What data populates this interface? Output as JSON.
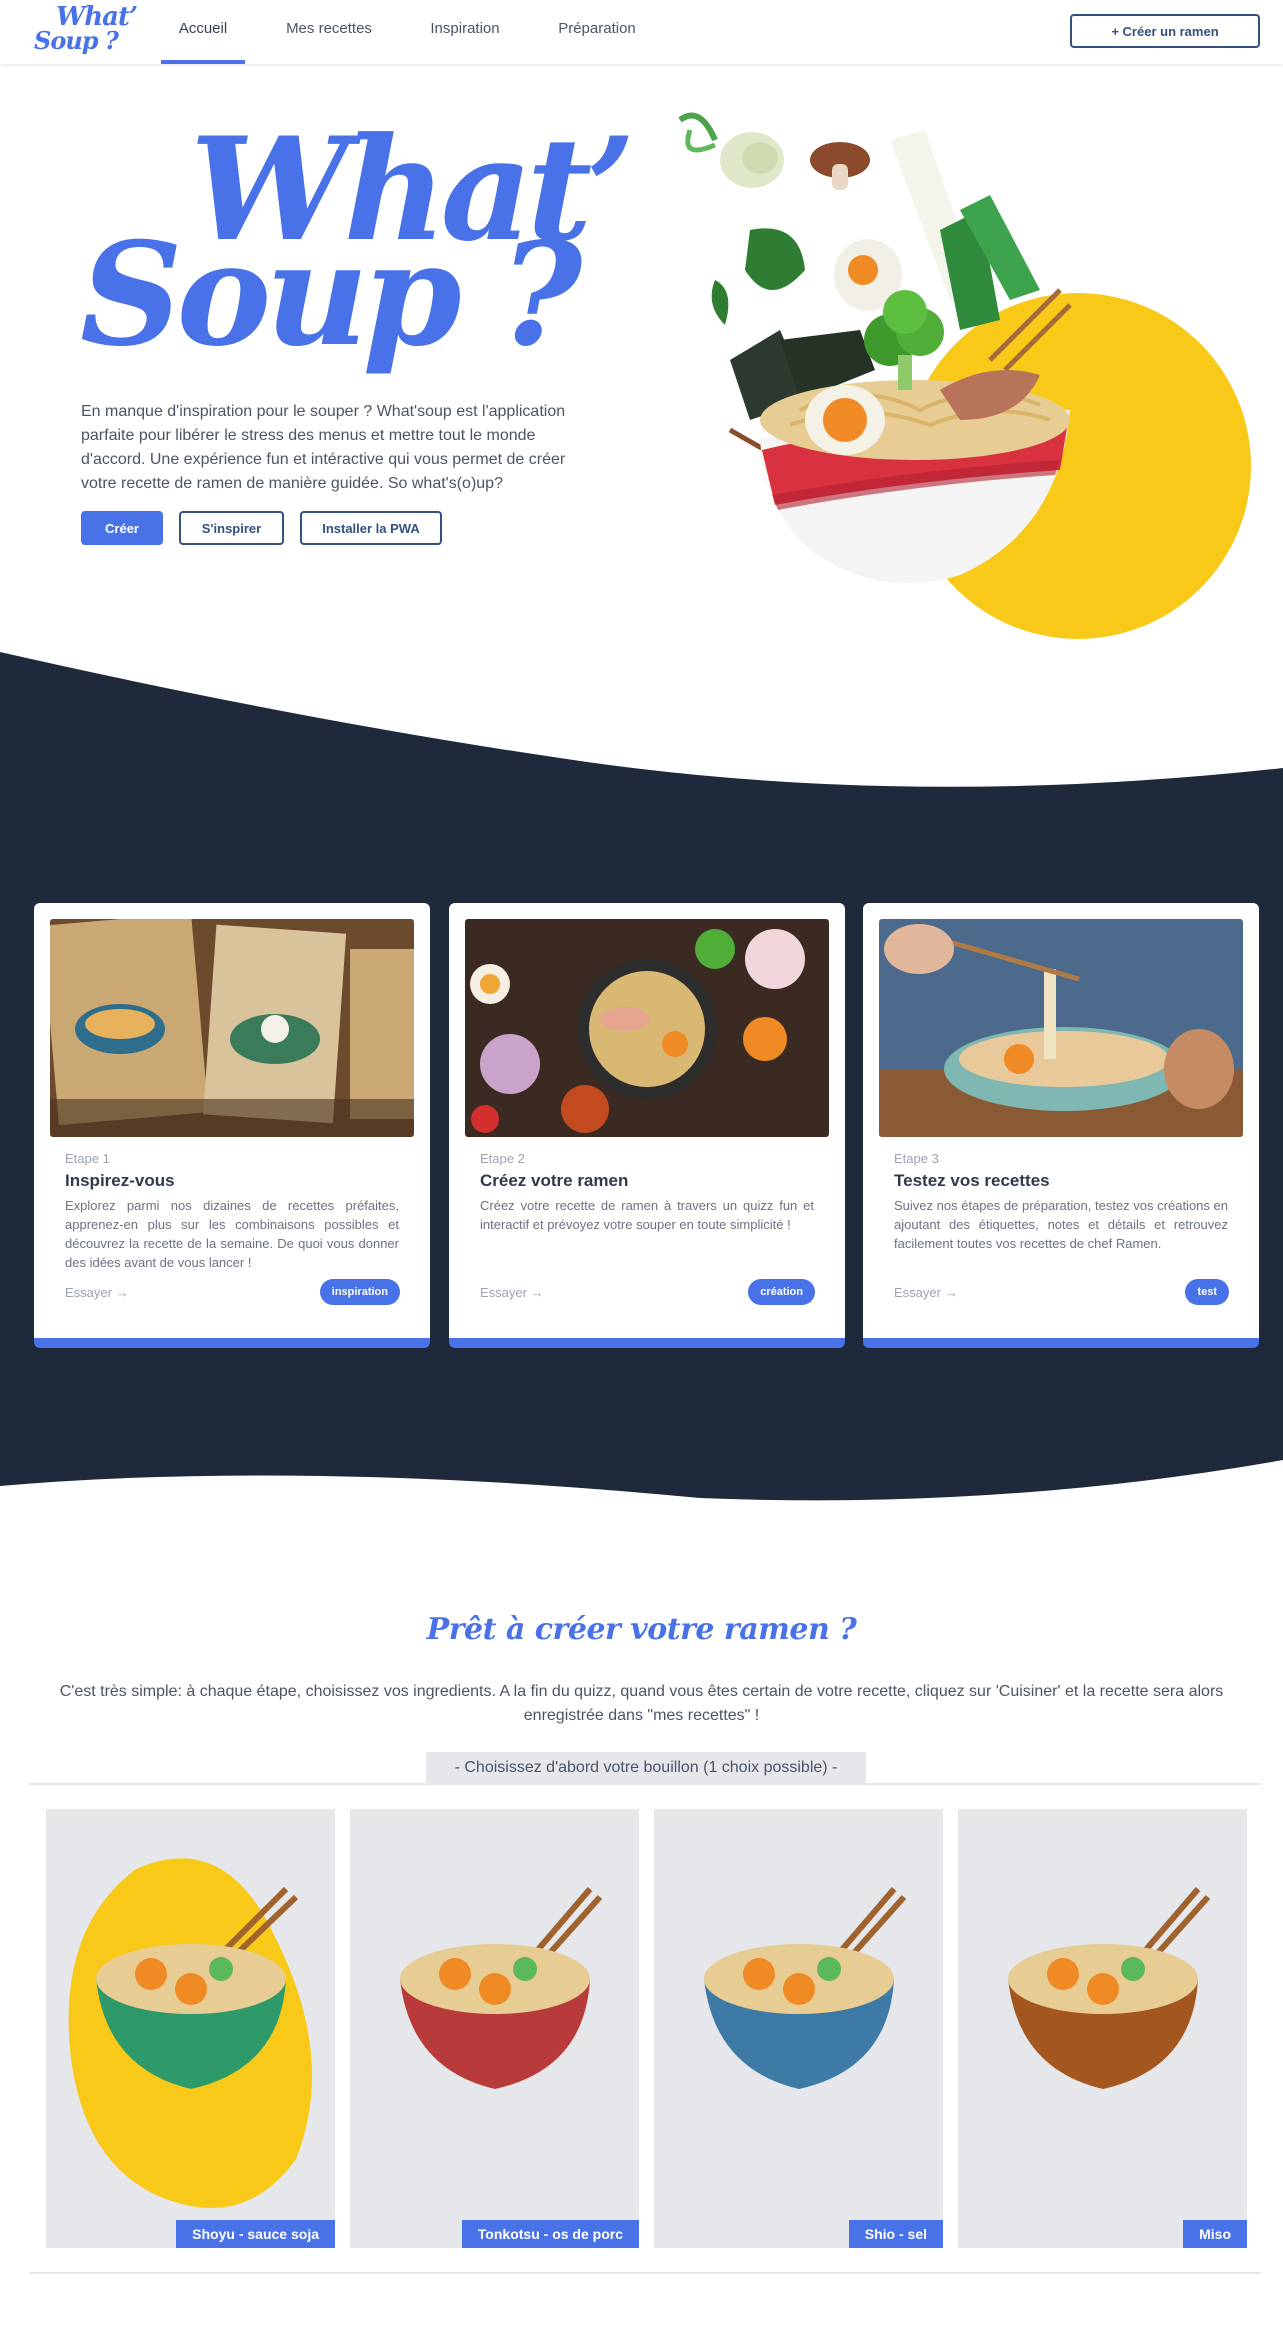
{
  "nav": {
    "logo_line1": "What’",
    "logo_line2": "Soup ?",
    "links": [
      "Accueil",
      "Mes recettes",
      "Inspiration",
      "Préparation"
    ],
    "cta": "+ Créer un ramen"
  },
  "hero": {
    "title_line1": "What’",
    "title_line2": "Soup ?",
    "text": "En manque d'inspiration pour le souper ? What'soup est l'application parfaite pour libérer le stress des menus et mettre tout le monde d'accord. Une expérience fun et intéractive qui vous permet de créer votre recette de ramen de manière guidée. So what's(o)up?",
    "buttons": [
      "Créer",
      "S'inspirer",
      "Installer la PWA"
    ]
  },
  "steps": [
    {
      "step": "Etape 1",
      "title": "Inspirez-vous",
      "desc": "Explorez parmi nos dizaines de recettes préfaites, apprenez-en plus sur les combinaisons possibles et découvrez la recette de la semaine. De quoi vous donner des idées avant de vous lancer !",
      "link": "Essayer →",
      "tag": "inspiration"
    },
    {
      "step": "Etape 2",
      "title": "Créez votre ramen",
      "desc": "Créez votre recette de ramen à travers un quizz fun et interactif et prévoyez votre souper en toute simplicité !",
      "link": "Essayer →",
      "tag": "création"
    },
    {
      "step": "Etape 3",
      "title": "Testez vos recettes",
      "desc": "Suivez nos étapes de préparation, testez vos créations en ajoutant des étiquettes, notes et détails et retrouvez facilement toutes vos recettes de chef Ramen.",
      "link": "Essayer →",
      "tag": "test"
    }
  ],
  "quiz": {
    "title": "Prêt à créer votre ramen ?",
    "text": "C'est très simple: à chaque étape, choisissez vos ingredients. A la fin du quizz, quand vous êtes certain de votre recette, cliquez sur 'Cuisiner' et la recette sera alors enregistrée dans \"mes recettes\" !",
    "step_label": "- Choisissez d'abord votre bouillon (1 choix possible) -",
    "broths": [
      {
        "label": "Shoyu - sauce soja",
        "bowl_color": "#2e9a6a",
        "selected": true
      },
      {
        "label": "Tonkotsu - os de porc",
        "bowl_color": "#b83a3a",
        "selected": false
      },
      {
        "label": "Shio - sel",
        "bowl_color": "#3d7aa6",
        "selected": false
      },
      {
        "label": "Miso",
        "bowl_color": "#a4561f",
        "selected": false
      }
    ]
  },
  "colors": {
    "accent": "#4a72e8",
    "navy": "#1e293b",
    "yellow": "#f9c91a"
  }
}
